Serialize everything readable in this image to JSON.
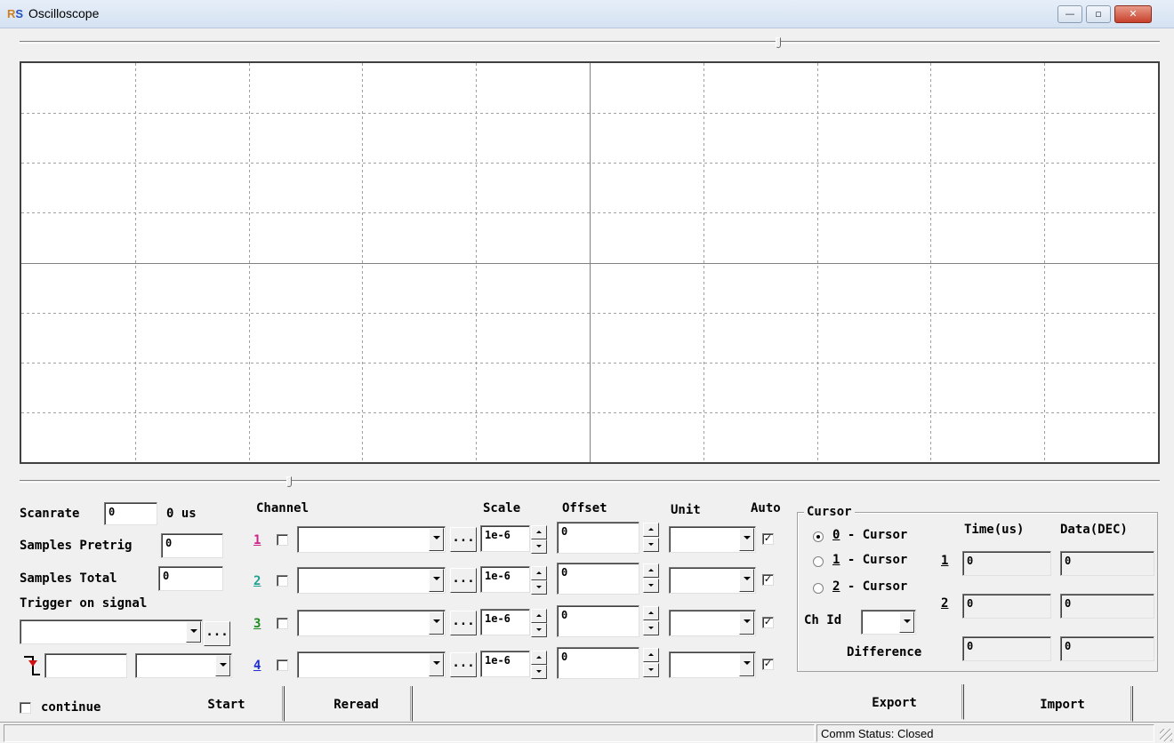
{
  "window": {
    "title": "Oscilloscope",
    "icon_text_r": "R",
    "icon_text_s": "S",
    "controls": {
      "minimize": "—",
      "maximize": "▫",
      "close": "✕"
    }
  },
  "scope": {
    "grid_cols": 10,
    "grid_rows": 8
  },
  "left": {
    "scanrate_label": "Scanrate",
    "scanrate_value": "0",
    "scanrate_unit": "0 us",
    "samples_pretrig_label": "Samples Pretrig",
    "samples_pretrig_value": "0",
    "samples_total_label": "Samples Total",
    "samples_total_value": "0",
    "trigger_label": "Trigger on signal",
    "trigger_signal_value": "",
    "trigger_browse": "...",
    "trigger_level_value": "",
    "trigger_edge_value": "",
    "continue_label": "continue",
    "continue_checked": false
  },
  "channels": {
    "header_channel": "Channel",
    "header_scale": "Scale",
    "header_offset": "Offset",
    "header_unit": "Unit",
    "header_auto": "Auto",
    "browse_label": "...",
    "rows": [
      {
        "num": "1",
        "color": "#d0208a",
        "enabled": false,
        "signal": "",
        "scale": "1e-6",
        "offset": "0",
        "unit": "",
        "auto": true
      },
      {
        "num": "2",
        "color": "#20a090",
        "enabled": false,
        "signal": "",
        "scale": "1e-6",
        "offset": "0",
        "unit": "",
        "auto": true
      },
      {
        "num": "3",
        "color": "#208a20",
        "enabled": false,
        "signal": "",
        "scale": "1e-6",
        "offset": "0",
        "unit": "",
        "auto": true
      },
      {
        "num": "4",
        "color": "#2030d0",
        "enabled": false,
        "signal": "",
        "scale": "1e-6",
        "offset": "0",
        "unit": "",
        "auto": true
      }
    ]
  },
  "cursor": {
    "group_label": "Cursor",
    "time_header": "Time(us)",
    "data_header": "Data(DEC)",
    "radio_0": "0",
    "radio_0_text": " - Cursor",
    "radio_1": "1",
    "radio_1_text": " - Cursor",
    "radio_2": "2",
    "radio_2_text": " - Cursor",
    "selected": 0,
    "row1_label": "1",
    "row2_label": "2",
    "time1": "0",
    "data1": "0",
    "time2": "0",
    "data2": "0",
    "chid_label": "Ch Id",
    "chid_value": "",
    "difference_label": "Difference",
    "diff_time": "0",
    "diff_data": "0"
  },
  "buttons": {
    "start": "Start",
    "reread": "Reread",
    "export": "Export",
    "import": "Import"
  },
  "status": {
    "comm": "Comm Status: Closed"
  }
}
